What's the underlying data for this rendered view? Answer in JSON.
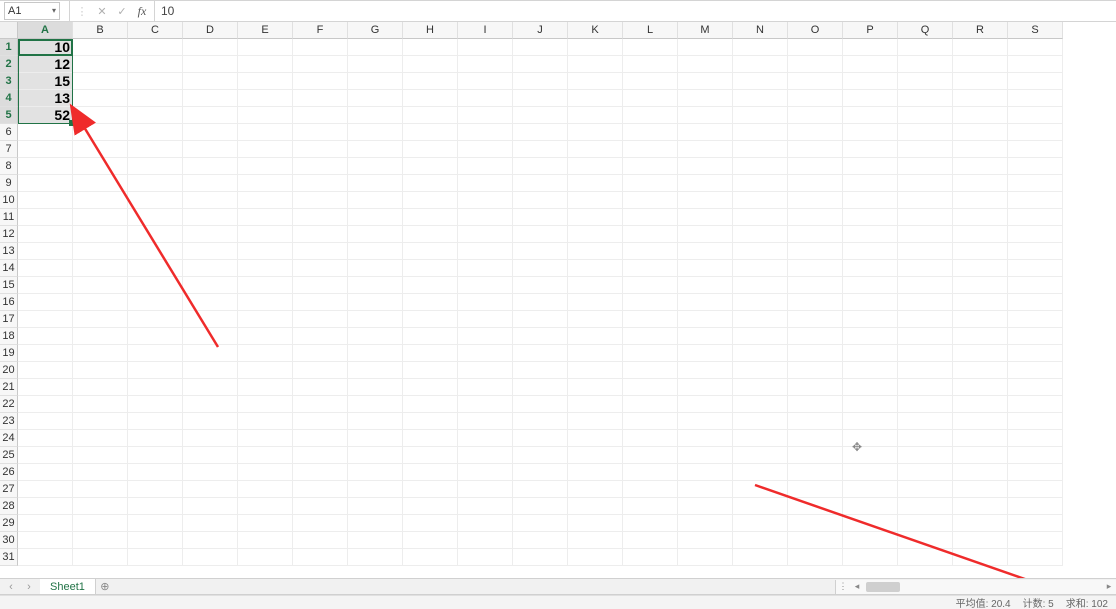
{
  "formula_bar": {
    "name_box": "A1",
    "cancel_icon": "✕",
    "confirm_icon": "✓",
    "fx_icon": "fx",
    "value": "10"
  },
  "columns": [
    "A",
    "B",
    "C",
    "D",
    "E",
    "F",
    "G",
    "H",
    "I",
    "J",
    "K",
    "L",
    "M",
    "N",
    "O",
    "P",
    "Q",
    "R",
    "S"
  ],
  "selected_col_index": 0,
  "row_count": 31,
  "selected_rows": [
    1,
    2,
    3,
    4,
    5
  ],
  "cells": {
    "A1": "10",
    "A2": "12",
    "A3": "15",
    "A4": "13",
    "A5": "52"
  },
  "sheet_tabs": {
    "nav_prev": "‹",
    "nav_next": "›",
    "active": "Sheet1",
    "add": "⊕"
  },
  "status": {
    "avg_label": "平均值: 20.4",
    "count_label": "计数: 5",
    "sum_label": "求和: 102"
  }
}
